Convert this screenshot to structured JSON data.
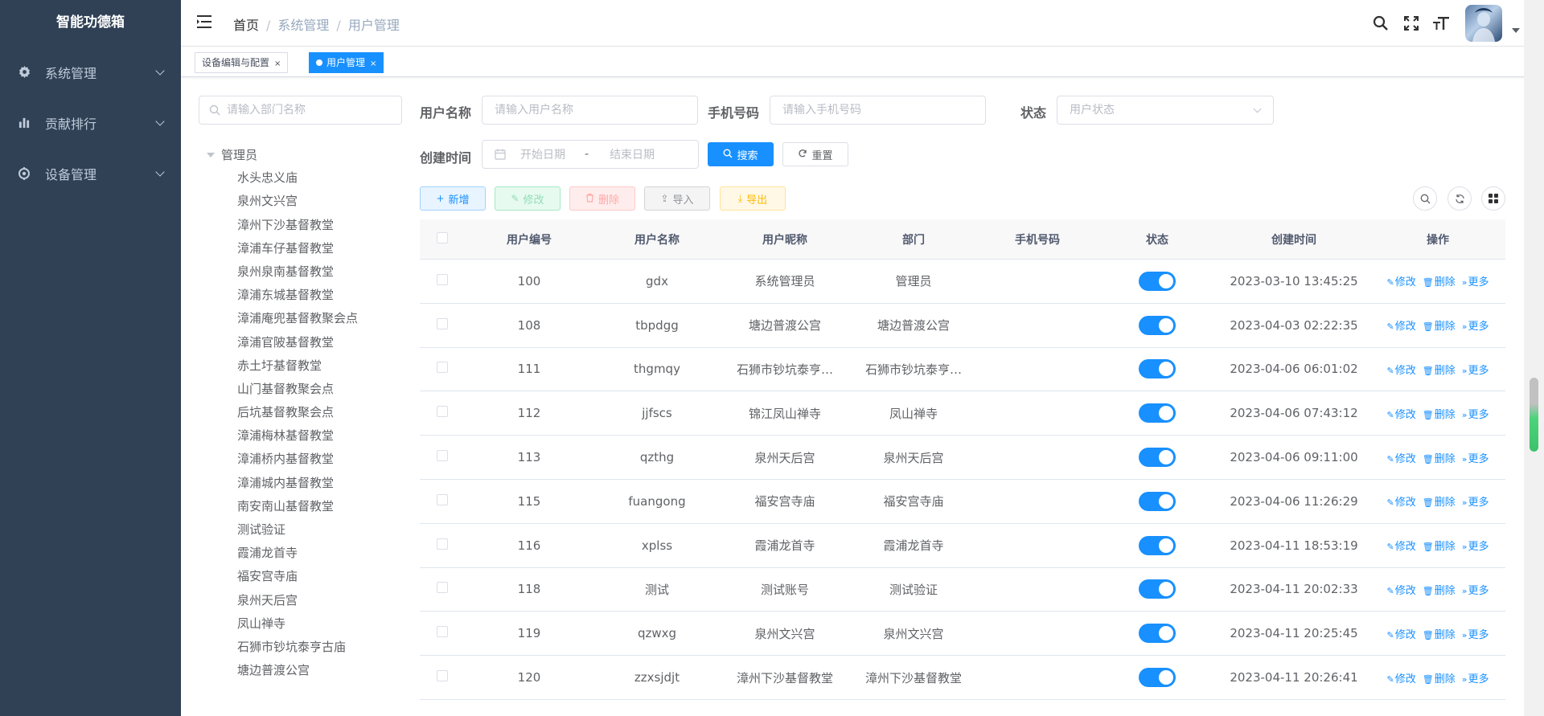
{
  "app": {
    "title": "智能功德箱"
  },
  "sidebar": {
    "items": [
      {
        "label": "系统管理",
        "icon": "gear-icon"
      },
      {
        "label": "贡献排行",
        "icon": "bar-chart-icon"
      },
      {
        "label": "设备管理",
        "icon": "device-icon"
      }
    ]
  },
  "breadcrumb": {
    "home": "首页",
    "level1": "系统管理",
    "level2": "用户管理"
  },
  "tags": {
    "tab1": "设备编辑与配置",
    "tab2": "用户管理",
    "close": "×"
  },
  "dept": {
    "placeholder": "请输入部门名称",
    "root": "管理员",
    "nodes": [
      "水头忠义庙",
      "泉州文兴宫",
      "漳州下沙基督教堂",
      "漳浦车仔基督教堂",
      "泉州泉南基督教堂",
      "漳浦东城基督教堂",
      "漳浦庵兜基督教聚会点",
      "漳浦官陂基督教堂",
      "赤土圩基督教堂",
      "山门基督教聚会点",
      "后坑基督教聚会点",
      "漳浦梅林基督教堂",
      "漳浦桥内基督教堂",
      "漳浦城内基督教堂",
      "南安南山基督教堂",
      "测试验证",
      "霞浦龙首寺",
      "福安宫寺庙",
      "泉州天后宫",
      "凤山禅寺",
      "石狮市钞坑泰亨古庙",
      "塘边普渡公宫"
    ]
  },
  "form": {
    "username_label": "用户名称",
    "username_placeholder": "请输入用户名称",
    "phone_label": "手机号码",
    "phone_placeholder": "请输入手机号码",
    "status_label": "状态",
    "status_placeholder": "用户状态",
    "created_label": "创建时间",
    "start_placeholder": "开始日期",
    "range_sep": "-",
    "end_placeholder": "结束日期",
    "search": "搜索",
    "reset": "重置"
  },
  "toolbar": {
    "add": "新增",
    "edit": "修改",
    "delete": "删除",
    "import": "导入",
    "export": "导出"
  },
  "table": {
    "headers": [
      "用户编号",
      "用户名称",
      "用户昵称",
      "部门",
      "手机号码",
      "状态",
      "创建时间",
      "操作"
    ],
    "op_edit": "修改",
    "op_delete": "删除",
    "op_more": "更多",
    "rows": [
      {
        "id": "100",
        "name": "gdx",
        "nick": "系统管理员",
        "dept": "管理员",
        "phone": "",
        "status": true,
        "created": "2023-03-10 13:45:25"
      },
      {
        "id": "108",
        "name": "tbpdgg",
        "nick": "塘边普渡公宫",
        "dept": "塘边普渡公宫",
        "phone": "",
        "status": true,
        "created": "2023-04-03 02:22:35"
      },
      {
        "id": "111",
        "name": "thgmqy",
        "nick": "石狮市钞坑泰亨…",
        "dept": "石狮市钞坑泰亨…",
        "phone": "",
        "status": true,
        "created": "2023-04-06 06:01:02"
      },
      {
        "id": "112",
        "name": "jjfscs",
        "nick": "锦江凤山禅寺",
        "dept": "凤山禅寺",
        "phone": "",
        "status": true,
        "created": "2023-04-06 07:43:12"
      },
      {
        "id": "113",
        "name": "qzthg",
        "nick": "泉州天后宫",
        "dept": "泉州天后宫",
        "phone": "",
        "status": true,
        "created": "2023-04-06 09:11:00"
      },
      {
        "id": "115",
        "name": "fuangong",
        "nick": "福安宫寺庙",
        "dept": "福安宫寺庙",
        "phone": "",
        "status": true,
        "created": "2023-04-06 11:26:29"
      },
      {
        "id": "116",
        "name": "xplss",
        "nick": "霞浦龙首寺",
        "dept": "霞浦龙首寺",
        "phone": "",
        "status": true,
        "created": "2023-04-11 18:53:19"
      },
      {
        "id": "118",
        "name": "测试",
        "nick": "测试账号",
        "dept": "测试验证",
        "phone": "",
        "status": true,
        "created": "2023-04-11 20:02:33"
      },
      {
        "id": "119",
        "name": "qzwxg",
        "nick": "泉州文兴宫",
        "dept": "泉州文兴宫",
        "phone": "",
        "status": true,
        "created": "2023-04-11 20:25:45"
      },
      {
        "id": "120",
        "name": "zzxsjdjt",
        "nick": "漳州下沙基督教堂",
        "dept": "漳州下沙基督教堂",
        "phone": "",
        "status": true,
        "created": "2023-04-11 20:26:41"
      }
    ]
  }
}
